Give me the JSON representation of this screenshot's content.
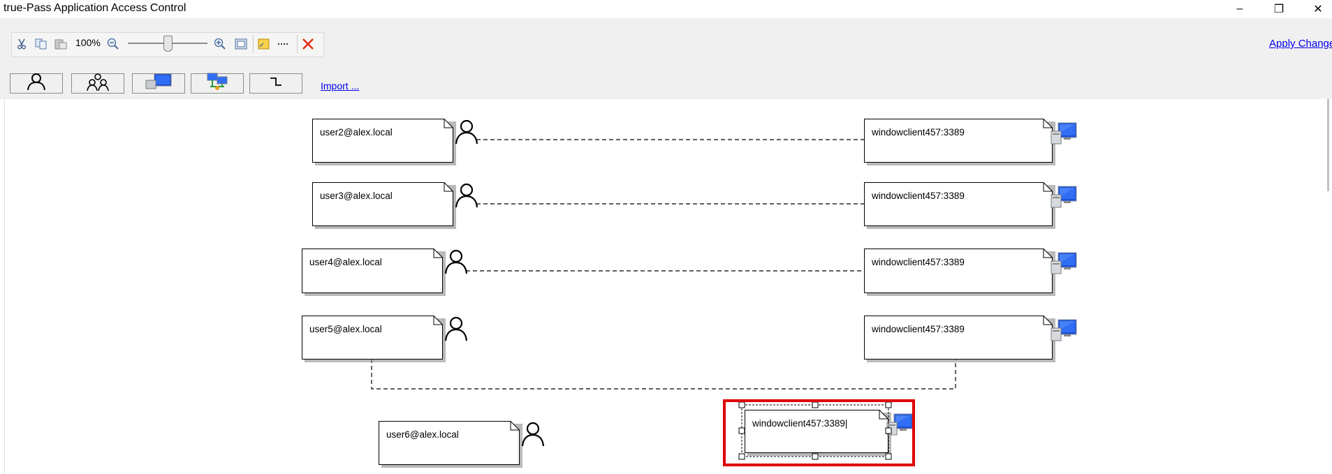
{
  "window": {
    "title": "true-Pass Application Access Control",
    "minimize_label": "–",
    "restore_label": "❐",
    "close_label": "✕"
  },
  "toolbar": {
    "zoom_label": "100%",
    "zoom_level": 100,
    "apply_label": "Apply Changes",
    "items": [
      "cut-icon",
      "copy-icon",
      "paste-icon",
      "zoom-out-icon",
      "zoom-slider",
      "zoom-in-icon",
      "fit-icon",
      "note-icon",
      "line-style-icon",
      "delete-icon"
    ]
  },
  "palette": {
    "buttons": [
      "user-icon",
      "group-icon",
      "computer-icon",
      "network-icon",
      "connector-icon"
    ],
    "import_label": "Import ..."
  },
  "diagram": {
    "users": [
      "user2@alex.local",
      "user3@alex.local",
      "user4@alex.local",
      "user5@alex.local",
      "user6@alex.local"
    ],
    "servers": [
      "windowclient457:3389",
      "windowclient457:3389",
      "windowclient457:3389",
      "windowclient457:3389",
      "windowclient457:3389"
    ],
    "links": [
      {
        "from": "user2@alex.local",
        "to": "windowclient457:3389",
        "style": "dashed"
      },
      {
        "from": "user3@alex.local",
        "to": "windowclient457:3389",
        "style": "dashed"
      },
      {
        "from": "user4@alex.local",
        "to": "windowclient457:3389",
        "style": "dashed"
      },
      {
        "from": "user5@alex.local",
        "to": "windowclient457:3389",
        "style": "dashed-elbow"
      }
    ],
    "selected_server": "windowclient457:3389"
  },
  "colors": {
    "selection": "#e00000",
    "link": "#0000ee",
    "delete": "#e03010"
  }
}
